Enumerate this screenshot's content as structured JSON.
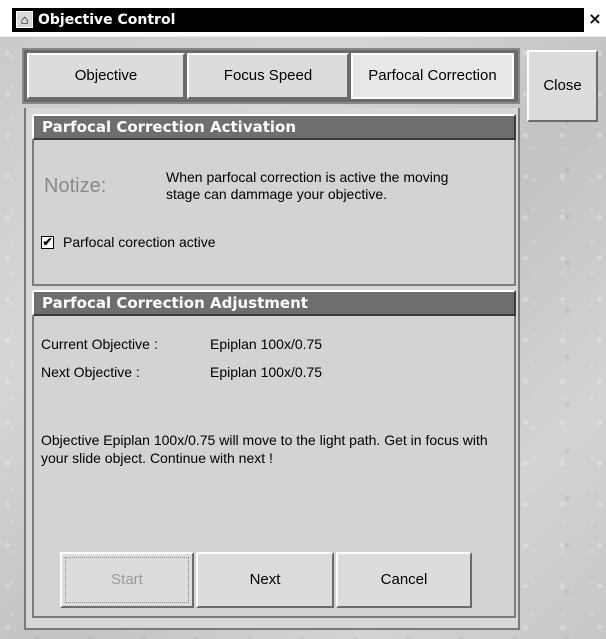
{
  "window": {
    "title": "Objective Control",
    "icon": "app-icon",
    "close_glyph": "×"
  },
  "tabs": [
    {
      "label": "Objective",
      "active": false
    },
    {
      "label": "Focus Speed",
      "active": false
    },
    {
      "label": "Parfocal Correction",
      "active": true
    }
  ],
  "close_button": {
    "label": "Close"
  },
  "activation": {
    "header": "Parfocal Correction Activation",
    "notice_label": "Notize:",
    "notice_text": "When parfocal correction is active the moving stage can dammage your objective.",
    "checkbox_label": "Parfocal corection active",
    "checkbox_checked": true
  },
  "adjustment": {
    "header": "Parfocal Correction Adjustment",
    "current_label": "Current Objective :",
    "current_value": "Epiplan 100x/0.75",
    "next_label": "Next Objective :",
    "next_value": "Epiplan 100x/0.75",
    "info_text": "Objective Epiplan 100x/0.75 will move to the light path. Get in focus with your slide object. Continue with next !"
  },
  "buttons": {
    "start": "Start",
    "next": "Next",
    "cancel": "Cancel"
  },
  "colors": {
    "header_bg": "#6e6e6e",
    "panel_bg": "#d3d3d3",
    "disabled_text": "#9a9a9a"
  }
}
